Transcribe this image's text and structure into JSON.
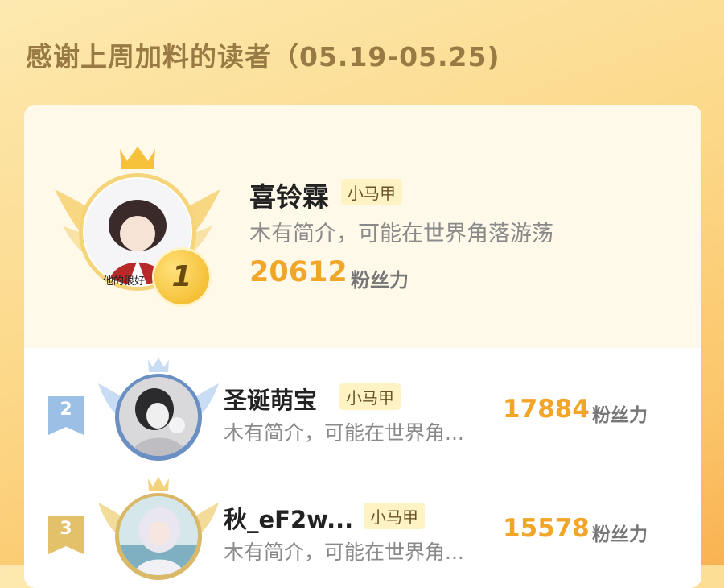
{
  "page": {
    "title": "感谢上周加料的读者（05.19-05.25)"
  },
  "readers": [
    {
      "rank": "1",
      "name": "喜铃霖",
      "tag": "小马甲",
      "bio": "木有简介，可能在世界角落游荡",
      "fans": "20612",
      "fans_label": "粉丝力",
      "avatar_caption": "他的很好"
    },
    {
      "rank": "2",
      "name": "圣诞萌宝",
      "tag": "小马甲",
      "bio": "木有简介，可能在世界角...",
      "fans": "17884",
      "fans_label": "粉丝力"
    },
    {
      "rank": "3",
      "name": "秋_eF2w...",
      "tag": "小马甲",
      "bio": "木有简介，可能在世界角...",
      "fans": "15578",
      "fans_label": "粉丝力"
    }
  ],
  "colors": {
    "gold": "#f1a62a",
    "silver": "#9cbfe6",
    "bronze": "#e3c06a",
    "tag_bg": "#fff3c4"
  }
}
